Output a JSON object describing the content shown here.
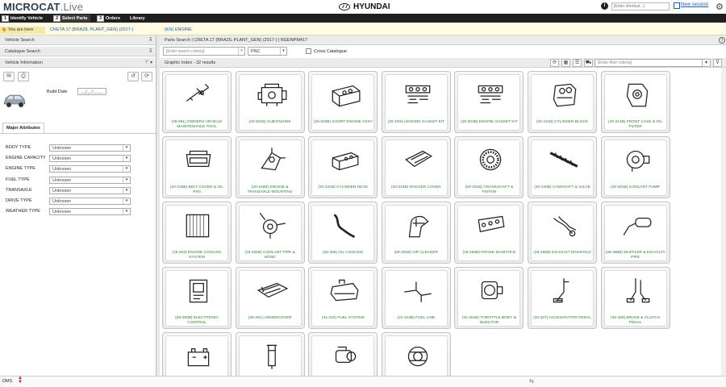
{
  "app": {
    "logo_main": "MICROCAT",
    "logo_sub": ".Live",
    "brand": "HYUNDAI"
  },
  "top": {
    "shortcut_placeholder": "[Enter shortcut...]",
    "transfer_label": "Transfer",
    "new_session": "New session"
  },
  "nav": {
    "tabs": [
      {
        "num": "1",
        "label": "Identify Vehicle"
      },
      {
        "num": "2",
        "label": "Select Parts"
      },
      {
        "num": "3",
        "label": "Orders"
      },
      {
        "num": "",
        "label": "Library"
      }
    ]
  },
  "breadcrumb": {
    "here": "You are here",
    "items": [
      "CRETA 17 (BRAZIL PLANT_GEN) (2017-)",
      "(EN) ENGINE"
    ]
  },
  "left": {
    "vehicle_search": "Vehicle Search",
    "catalogue_search": "Catalogue Search",
    "vehicle_information": "Vehicle Information",
    "build_date_label": "Build Date",
    "build_date_value": "__/__/____",
    "major_attributes_tab": "Major Attributes",
    "attributes": [
      {
        "label": "BODY TYPE",
        "value": "Unknown"
      },
      {
        "label": "ENGINE CAPACITY",
        "value": "Unknown"
      },
      {
        "label": "ENGINE TYPE",
        "value": "Unknown"
      },
      {
        "label": "FUEL TYPE",
        "value": "Unknown"
      },
      {
        "label": "TRANSAXLE",
        "value": "Unknown"
      },
      {
        "label": "DRIVE TYPE",
        "value": "Unknown"
      },
      {
        "label": "WEATHER TYPE",
        "value": "Unknown"
      }
    ]
  },
  "parts": {
    "header": "Parts Search | CRETA 17 (BRAZIL PLANT_GEN) (2017-) | BGENPM417",
    "search_placeholder": "[Enter search criteria]",
    "search_mode": "PNC",
    "cross_catalogue": "Cross Catalogue",
    "graphic_index": "Graphic Index - 32 results",
    "filter_placeholder": "[Enter filter criteria]",
    "tiles": [
      {
        "label": "(09-091) OWNERS VEHICLE MAINTENANCE TOOL",
        "icon": "tool-kit"
      },
      {
        "label": "(20-201B) SUB ENGINE",
        "icon": "engine"
      },
      {
        "label": "(20-202B) SHORT ENGINE ASSY",
        "icon": "engine-block"
      },
      {
        "label": "(20-203A) ENGINE GASKET KIT",
        "icon": "gaskets"
      },
      {
        "label": "(20-203B) ENGINE GASKET KIT",
        "icon": "gaskets"
      },
      {
        "label": "(20-211B) CYLINDER BLOCK",
        "icon": "cylinder-block"
      },
      {
        "label": "(20-213B) FRONT CASE & OIL FILTER",
        "icon": "front-case"
      },
      {
        "label": "(20-215B) BELT COVER & OIL PAN",
        "icon": "oil-pan"
      },
      {
        "label": "(20-216B) ENGINE & TRANSAXLE MOUNTING",
        "icon": "mount"
      },
      {
        "label": "(20-221B) CYLINDER HEAD",
        "icon": "cylinder-head"
      },
      {
        "label": "(20-224B) ROCKER COVER",
        "icon": "rocker-cover"
      },
      {
        "label": "(20-231B) CRANKSHAFT & PISTON",
        "icon": "flywheel"
      },
      {
        "label": "(20-240B) CAMSHAFT & VALVE",
        "icon": "camshaft"
      },
      {
        "label": "(20-251B) COOLANT PUMP",
        "icon": "pump"
      },
      {
        "label": "(25-253) ENGINE COOLING SYSTEM",
        "icon": "radiator"
      },
      {
        "label": "(25-255B) COOLANT PIPE & HOSE",
        "icon": "thermostat"
      },
      {
        "label": "(25-256) OIL COOLING",
        "icon": "hose"
      },
      {
        "label": "(28-281B) AIR CLEANER",
        "icon": "air-cleaner"
      },
      {
        "label": "(28-283B) INTAKE MANIFOLD",
        "icon": "manifold"
      },
      {
        "label": "(28-285B) EXHAUST MANIFOLD",
        "icon": "exhaust-manifold"
      },
      {
        "label": "(28-286B) MUFFLER & EXHAUST PIPE",
        "icon": "muffler"
      },
      {
        "label": "(28-390B) ELECTRONIC CONTROL",
        "icon": "ecu"
      },
      {
        "label": "(29-291) UNDERCOVER",
        "icon": "undercover"
      },
      {
        "label": "(31-310) FUEL SYSTEM",
        "icon": "fuel-tank"
      },
      {
        "label": "(31-313B) FUEL LINE",
        "icon": "fuel-line"
      },
      {
        "label": "(31-351B) THROTTLE BODY & INJECTOR",
        "icon": "throttle"
      },
      {
        "label": "(32-327) ACCELERATOR PEDAL",
        "icon": "pedal"
      },
      {
        "label": "(32-328) BRAKE & CLUTCH PEDAL",
        "icon": "pedal-2"
      },
      {
        "label": "",
        "icon": "battery"
      },
      {
        "label": "",
        "icon": "ignition-coil"
      },
      {
        "label": "",
        "icon": "starter"
      },
      {
        "label": "",
        "icon": "alternator"
      }
    ]
  },
  "status": {
    "dms": "DMS"
  }
}
